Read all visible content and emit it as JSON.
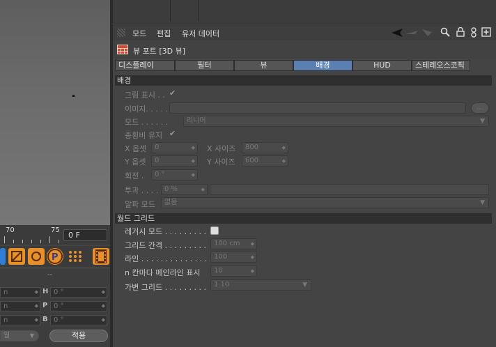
{
  "menu": {
    "items": [
      "모드",
      "편집",
      "유저 데이터"
    ]
  },
  "panel": {
    "title": "뷰 포트 [3D 뷰]"
  },
  "tabs": [
    "디스플레이",
    "필터",
    "뷰",
    "배경",
    "HUD",
    "스테레오스코픽"
  ],
  "active_tab": "배경",
  "background_section": {
    "header": "배경",
    "show_image": {
      "label": "그림 표시 . .",
      "checked": true
    },
    "image": {
      "label": "이미지. . . . .",
      "value": "",
      "browse_label": "..."
    },
    "mode": {
      "label": "모드 . . . . . .",
      "value": "리니어"
    },
    "keep_aspect": {
      "label": "종횡비 유지",
      "checked": true
    },
    "x_offset": {
      "label": "X 옵셋",
      "value": "0"
    },
    "y_offset": {
      "label": "Y 옵셋",
      "value": "0"
    },
    "x_size": {
      "label": "X 사이즈",
      "value": "800"
    },
    "y_size": {
      "label": "Y 사이즈",
      "value": "600"
    },
    "rotation": {
      "label": "회전 .",
      "value": "0 °"
    },
    "transparency": {
      "label": "투과 . . . .",
      "value": "0 %"
    },
    "alpha_mode": {
      "label": "알파 모드",
      "value": "없음"
    }
  },
  "grid_section": {
    "header": "월드 그리드",
    "legacy_mode": {
      "label": "레거시 모드 . . . . . . . . .",
      "checked": false
    },
    "grid_spacing": {
      "label": "그리드 간격 . . . . . . . . .",
      "value": "100 cm"
    },
    "lines": {
      "label": "라인 . . . . . . . . . . . . . . .",
      "value": "100"
    },
    "major_line": {
      "label": "n 칸마다 메인라인 표시",
      "value": "10"
    },
    "dynamic_grid": {
      "label": "가변 그리드 . . . . . . . . .",
      "value": "1.10"
    }
  },
  "timeline": {
    "tick_70": "70",
    "tick_75": "75",
    "frame": "0 F"
  },
  "coords": {
    "rows": [
      {
        "left_value": "n",
        "axis": "H",
        "value": "0 °"
      },
      {
        "left_value": "n",
        "axis": "P",
        "value": "0 °"
      },
      {
        "left_value": "n",
        "axis": "B",
        "value": "0 °"
      }
    ],
    "mode_value": "일",
    "apply_label": "적용",
    "separator": "--"
  },
  "colors": {
    "active_tab": "#5b7fb0",
    "panel_bg": "#444444",
    "section_bg": "#2f2f2f"
  }
}
